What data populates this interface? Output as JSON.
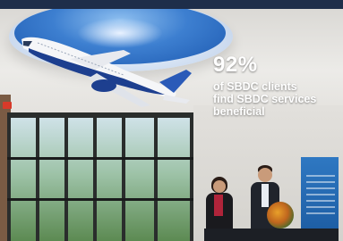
{
  "stat": {
    "value": "92%",
    "caption_lines": [
      "of SBDC clients",
      "find SBDC services",
      "beneficial"
    ]
  },
  "colors": {
    "text": "#ffffff",
    "ceiling_blue": "#3d7fd0",
    "airplane_blue": "#1d3f8f",
    "banner_blue": "#2f78c2"
  },
  "icons": {
    "airplane": "airplane-model",
    "exit_sign": "exit-sign"
  }
}
